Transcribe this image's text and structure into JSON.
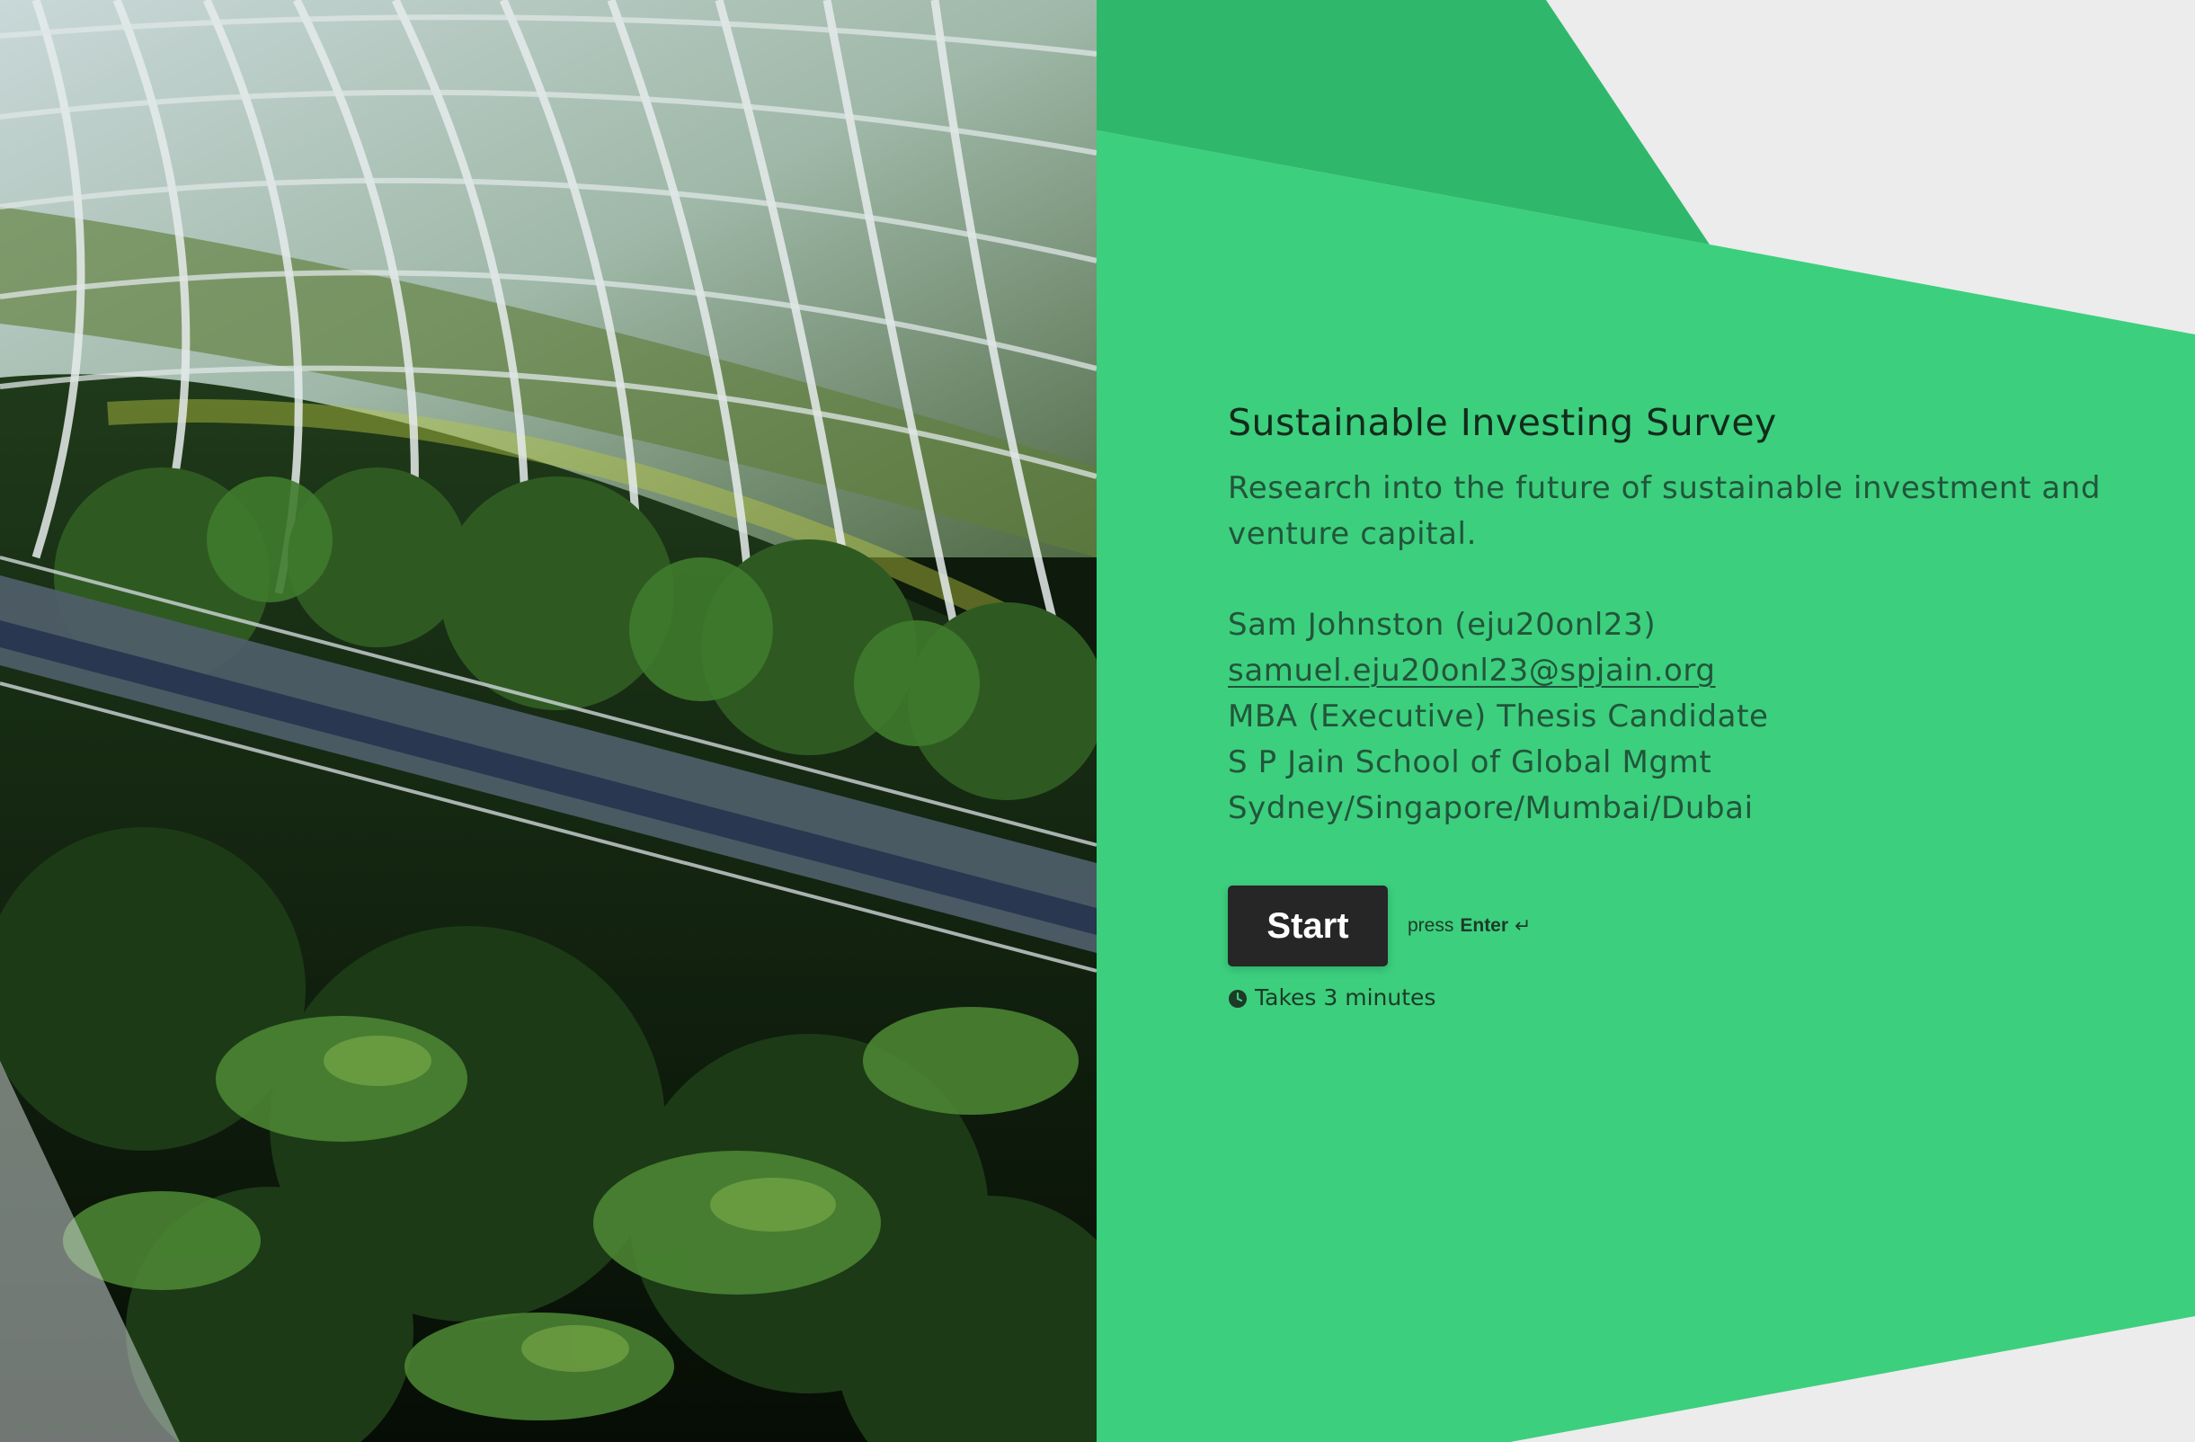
{
  "survey": {
    "title": "Sustainable Investing Survey",
    "description": "Research into the future of sustainable investment and venture capital."
  },
  "author": {
    "name": "Sam Johnston (eju20onl23)",
    "email": "samuel.eju20onl23@spjain.org",
    "role": "MBA (Executive) Thesis Candidate",
    "school": "S P Jain School of Global Mgmt",
    "campuses": "Sydney/Singapore/Mumbai/Dubai"
  },
  "actions": {
    "start_label": "Start",
    "hint_prefix": "press",
    "hint_key": "Enter",
    "hint_icon": "↵",
    "duration": "Takes 3 minutes"
  },
  "icons": {
    "enter": "enter-icon",
    "clock": "clock-icon"
  },
  "colors": {
    "green_main": "#3ccf7e",
    "green_dark": "#2fb86c",
    "background_gray": "#ebeceb",
    "button_bg": "#262626",
    "text_dark": "#132b1b",
    "text_body": "#22553a"
  }
}
